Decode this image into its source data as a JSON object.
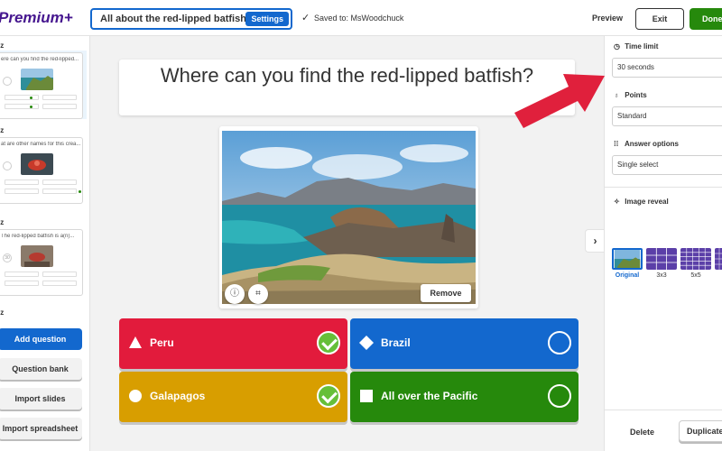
{
  "brand": "Premium+",
  "header": {
    "title": "All about the red-lipped batfish",
    "settings_label": "Settings",
    "saved_text": "Saved to: MsWoodchuck",
    "preview_label": "Preview",
    "exit_label": "Exit",
    "done_label": "Done"
  },
  "sidebar": {
    "slides": [
      {
        "label": "iz",
        "question": "ere can you find the red-lipped...",
        "time": ""
      },
      {
        "label": "iz",
        "question": "at are other names for this crea...",
        "time": ""
      },
      {
        "label": "iz",
        "question": "The red-lipped batfish is a(n)...",
        "time": "30"
      }
    ],
    "next_slide_label": "iz",
    "add_question_label": "Add question",
    "question_bank_label": "Question bank",
    "import_slides_label": "Import slides",
    "import_spreadsheet_label": "Import spreadsheet"
  },
  "editor": {
    "question": "Where can you find the red-lipped batfish?",
    "remove_label": "Remove",
    "answers": [
      {
        "text": "Peru",
        "shape": "triangle",
        "color": "#e21b3c",
        "correct": true
      },
      {
        "text": "Brazil",
        "shape": "diamond",
        "color": "#1368ce",
        "correct": false
      },
      {
        "text": "Galapagos",
        "shape": "circle",
        "color": "#d89e00",
        "correct": true
      },
      {
        "text": "All over the Pacific",
        "shape": "square",
        "color": "#26890c",
        "correct": false
      }
    ]
  },
  "right_panel": {
    "time_limit_label": "Time limit",
    "time_limit_value": "30 seconds",
    "points_label": "Points",
    "points_value": "Standard",
    "answer_options_label": "Answer options",
    "answer_options_value": "Single select",
    "image_reveal_label": "Image reveal",
    "reveal_options": [
      "Original",
      "3x3",
      "5x5",
      ""
    ],
    "delete_label": "Delete",
    "duplicate_label": "Duplicate"
  },
  "colors": {
    "brand": "#46178f",
    "accent": "#1368ce",
    "done": "#26890c",
    "annotation_arrow": "#e0203c",
    "correct": "#66bf39"
  }
}
